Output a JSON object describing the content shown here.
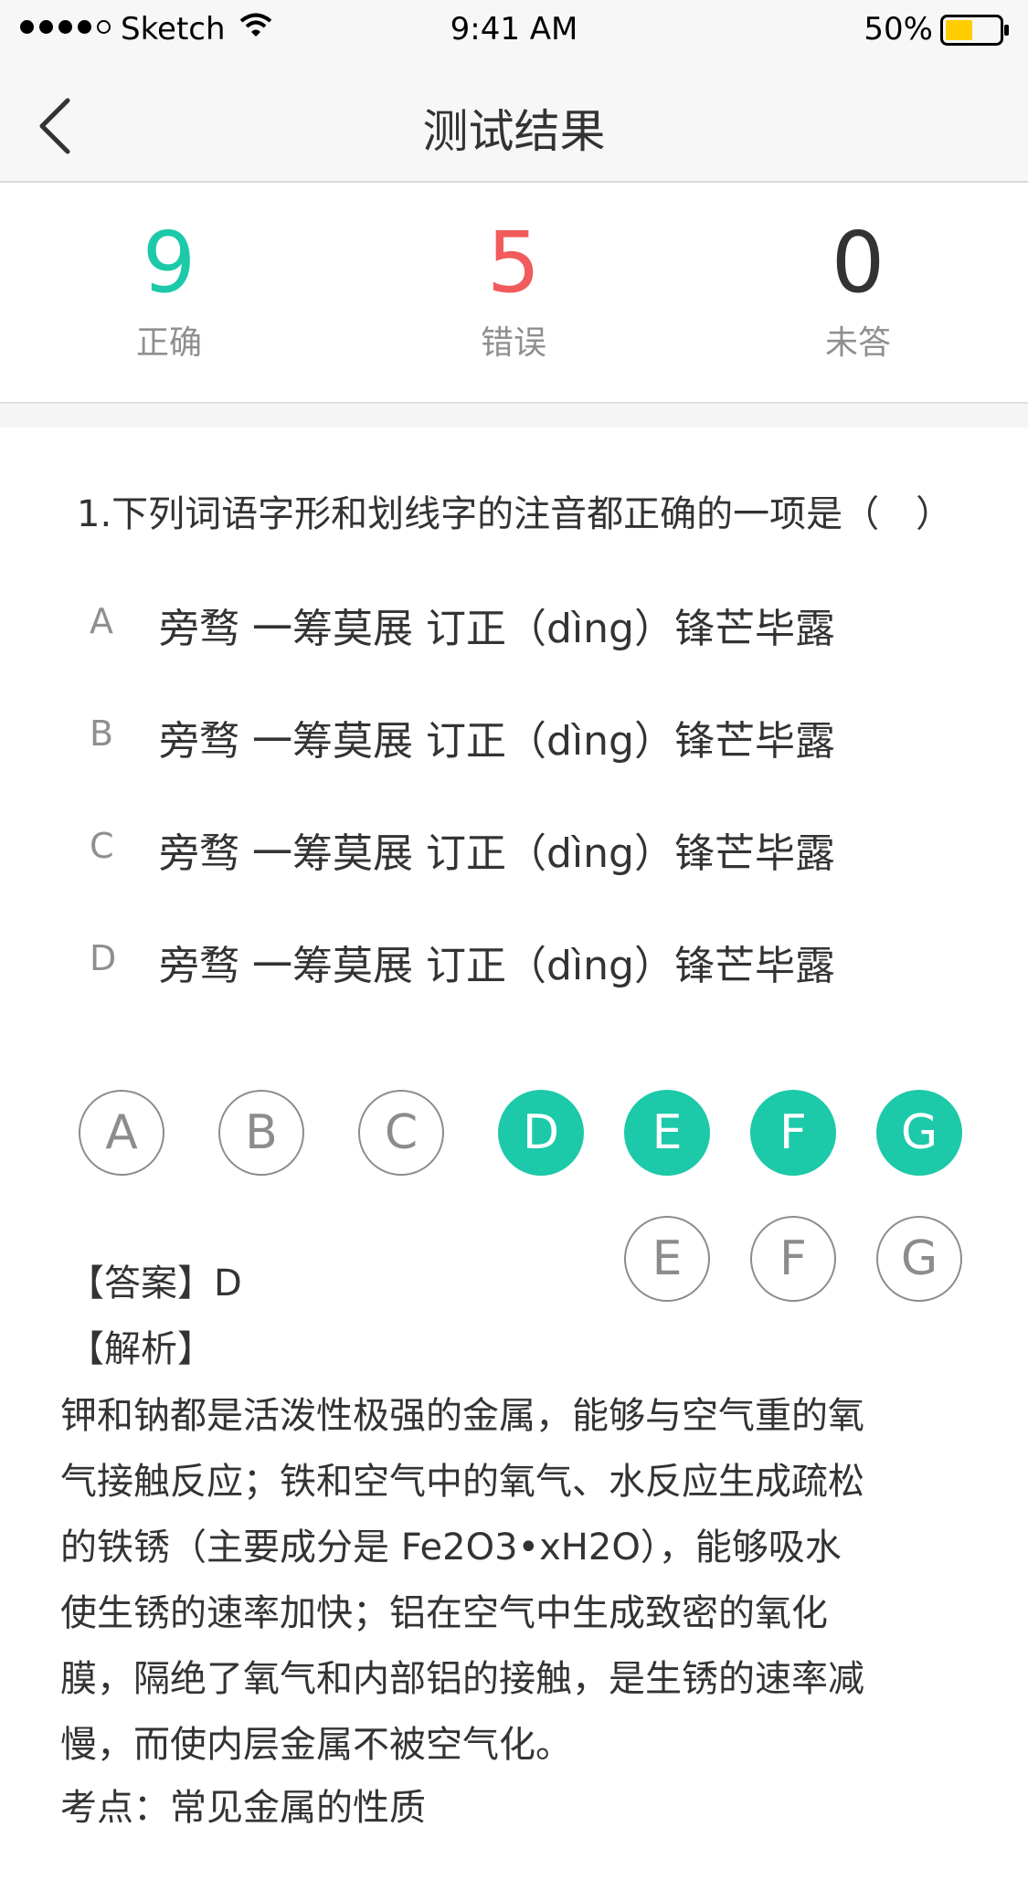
{
  "status_bar": {
    "carrier": "Sketch",
    "time": "9:41 AM",
    "battery": "50%",
    "battery_level": 0.5,
    "battery_color": "#ffcc00"
  },
  "nav": {
    "title": "测试结果",
    "back_icon": "chevron-left-icon"
  },
  "stats": {
    "correct": {
      "value": "9",
      "label": "正确",
      "color": "#1cc9a8"
    },
    "wrong": {
      "value": "5",
      "label": "错误",
      "color": "#f15b5b"
    },
    "unanswered": {
      "value": "0",
      "label": "未答",
      "color": "#333333"
    }
  },
  "question": {
    "text": "1.下列词语字形和划线字的注音都正确的一项是（　）",
    "options": [
      {
        "letter": "A",
        "text": "旁骛 一筹莫展 订正（dìng）锋芒毕露"
      },
      {
        "letter": "B",
        "text": "旁骛 一筹莫展 订正（dìng）锋芒毕露"
      },
      {
        "letter": "C",
        "text": "旁骛 一筹莫展 订正（dìng）锋芒毕露"
      },
      {
        "letter": "D",
        "text": "旁骛 一筹莫展 订正（dìng）锋芒毕露"
      }
    ]
  },
  "choices": {
    "accent": "#1cc9a8",
    "row1": [
      {
        "label": "A",
        "selected": false
      },
      {
        "label": "B",
        "selected": false
      },
      {
        "label": "C",
        "selected": false
      },
      {
        "label": "D",
        "selected": true
      },
      {
        "label": "E",
        "selected": true
      },
      {
        "label": "F",
        "selected": true
      },
      {
        "label": "G",
        "selected": true
      }
    ],
    "row2": [
      {
        "label": "E",
        "selected": false
      },
      {
        "label": "F",
        "selected": false
      },
      {
        "label": "G",
        "selected": false
      }
    ]
  },
  "analysis": {
    "answer": "【答案】D",
    "title": "【解析】",
    "lines": [
      "钾和钠都是活泼性极强的金属，能够与空气重的氧",
      "气接触反应；铁和空气中的氧气、水反应生成疏松",
      "的铁锈（主要成分是 Fe2O3•xH2O），能够吸水",
      "使生锈的速率加快；铝在空气中生成致密的氧化",
      "膜，隔绝了氧气和内部铝的接触，是生锈的速率减",
      "慢，而使内层金属不被空气化。"
    ],
    "kaodian": "考点：常见金属的性质"
  }
}
